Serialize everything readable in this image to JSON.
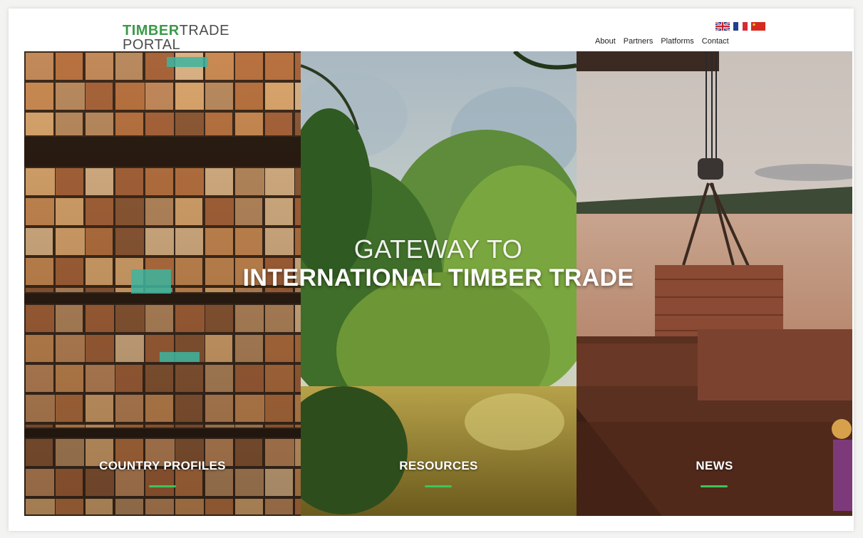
{
  "logo": {
    "line1_bold": "TIMBER",
    "line1_rest": "TRADE",
    "line2": "PORTAL"
  },
  "languages": [
    {
      "name": "uk-flag-icon"
    },
    {
      "name": "france-flag-icon"
    },
    {
      "name": "china-flag-icon"
    }
  ],
  "nav": {
    "about": "About",
    "partners": "Partners",
    "platforms": "Platforms",
    "contact": "Contact"
  },
  "hero": {
    "line1": "GATEWAY TO",
    "line2": "INTERNATIONAL TIMBER TRADE",
    "panels": [
      {
        "label": "COUNTRY PROFILES"
      },
      {
        "label": "RESOURCES"
      },
      {
        "label": "NEWS"
      }
    ]
  },
  "colors": {
    "brand_green": "#3a9a48",
    "accent_underline": "#3ec45a",
    "text_gray": "#4d4d4d"
  }
}
